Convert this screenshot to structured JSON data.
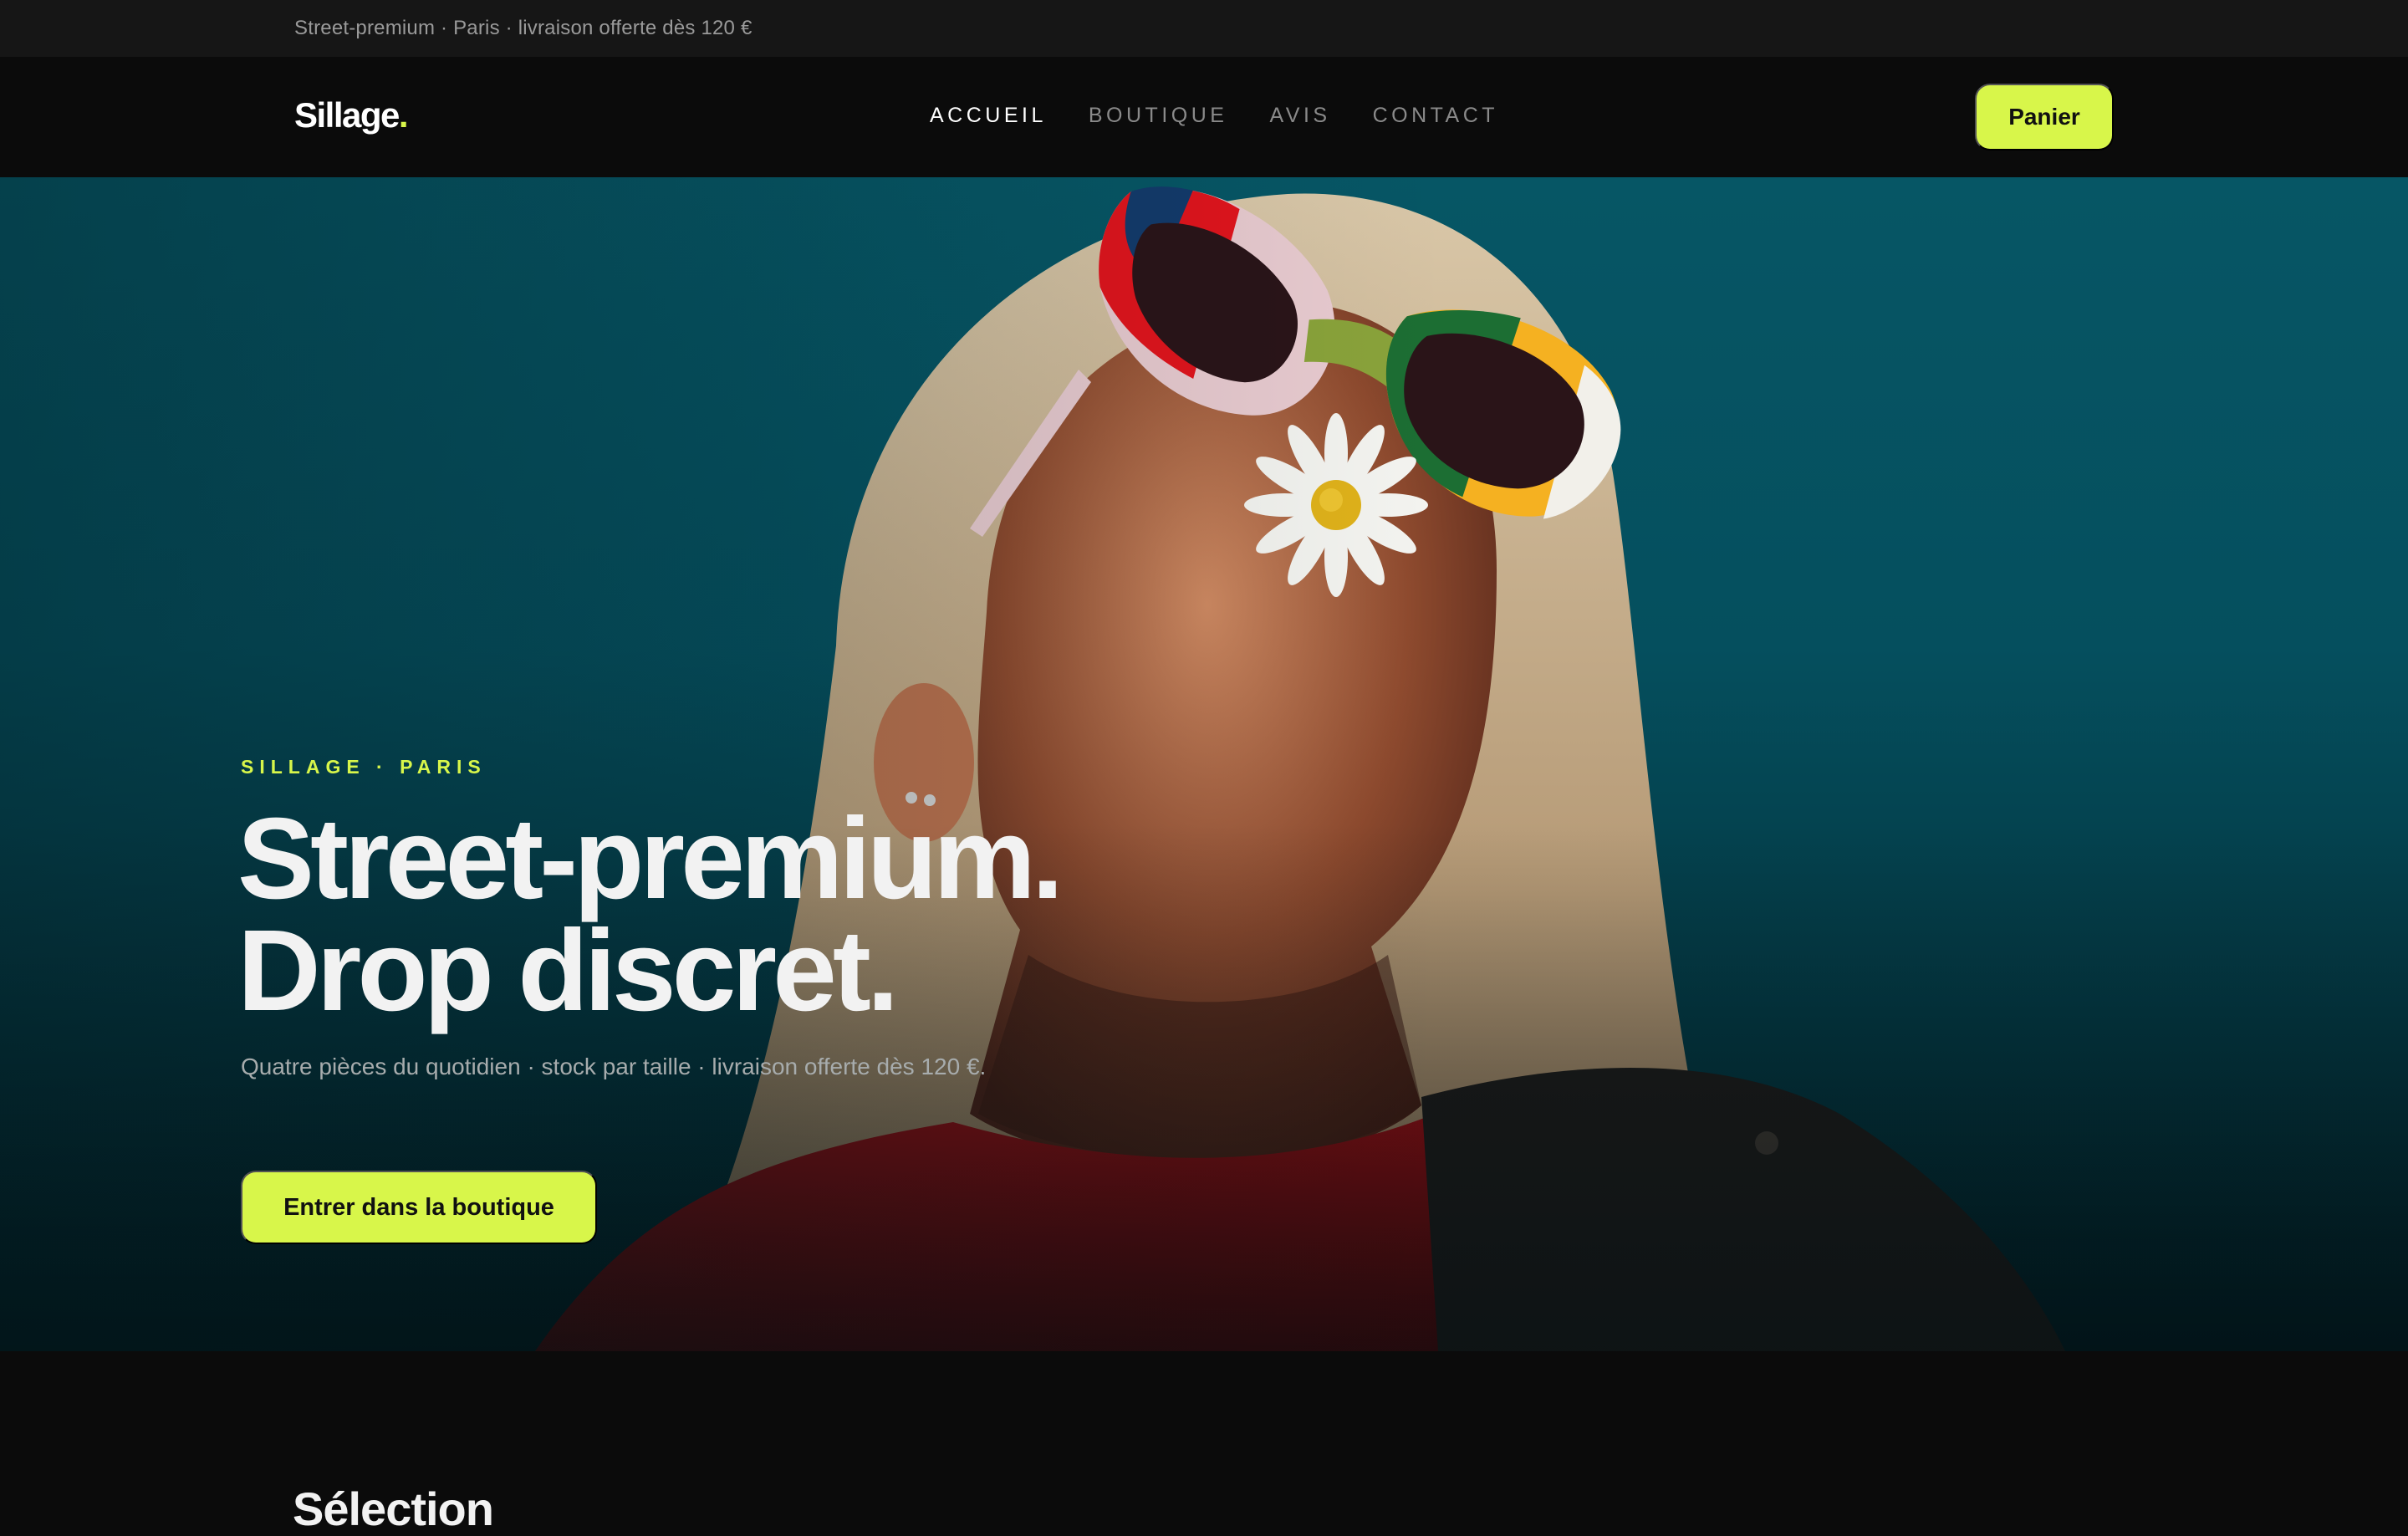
{
  "announcement": {
    "text": "Street-premium · Paris · livraison offerte dès 120 €"
  },
  "header": {
    "logo_text": "Sillage",
    "logo_dot": ".",
    "nav": [
      {
        "label": "ACCUEIL",
        "active": true
      },
      {
        "label": "BOUTIQUE",
        "active": false
      },
      {
        "label": "AVIS",
        "active": false
      },
      {
        "label": "CONTACT",
        "active": false
      }
    ],
    "cart_label": "Panier"
  },
  "hero": {
    "eyebrow": "SILLAGE · PARIS",
    "headline_line1": "Street-premium.",
    "headline_line2": "Drop discret.",
    "subtitle": "Quatre pièces du quotidien · stock par taille · livraison offerte dès 120 €.",
    "cta_label": "Entrer dans la boutique",
    "image_icon": "portrait-photo-icon"
  },
  "next_section": {
    "title": "Sélection"
  },
  "colors": {
    "accent": "#d8f64a",
    "background": "#0b0b0b",
    "topbar": "#161616",
    "hero_teal": "#065665"
  }
}
